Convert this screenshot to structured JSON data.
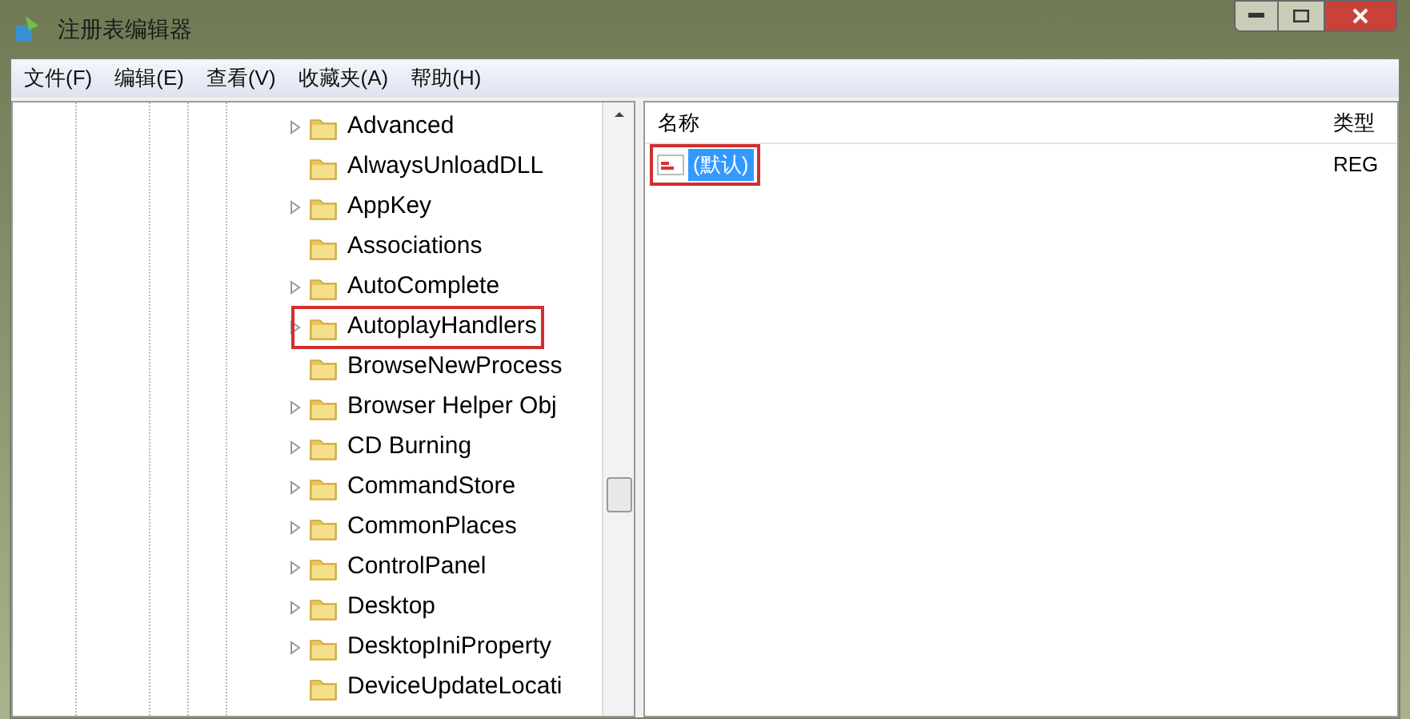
{
  "window": {
    "title": "注册表编辑器"
  },
  "menu": [
    "文件(F)",
    "编辑(E)",
    "查看(V)",
    "收藏夹(A)",
    "帮助(H)"
  ],
  "tree": [
    {
      "label": "Advanced",
      "expandable": true,
      "highlighted": false
    },
    {
      "label": "AlwaysUnloadDLL",
      "expandable": false,
      "highlighted": false
    },
    {
      "label": "AppKey",
      "expandable": true,
      "highlighted": false
    },
    {
      "label": "Associations",
      "expandable": false,
      "highlighted": false
    },
    {
      "label": "AutoComplete",
      "expandable": true,
      "highlighted": false
    },
    {
      "label": "AutoplayHandlers",
      "expandable": true,
      "highlighted": true
    },
    {
      "label": "BrowseNewProcess",
      "expandable": false,
      "highlighted": false
    },
    {
      "label": "Browser Helper Obj",
      "expandable": true,
      "highlighted": false
    },
    {
      "label": "CD Burning",
      "expandable": true,
      "highlighted": false
    },
    {
      "label": "CommandStore",
      "expandable": true,
      "highlighted": false
    },
    {
      "label": "CommonPlaces",
      "expandable": true,
      "highlighted": false
    },
    {
      "label": "ControlPanel",
      "expandable": true,
      "highlighted": false
    },
    {
      "label": "Desktop",
      "expandable": true,
      "highlighted": false
    },
    {
      "label": "DesktopIniProperty",
      "expandable": true,
      "highlighted": false
    },
    {
      "label": "DeviceUpdateLocati",
      "expandable": false,
      "highlighted": false
    }
  ],
  "values": {
    "columns": [
      "名称",
      "类型"
    ],
    "rows": [
      {
        "name": "(默认)",
        "type": "REG",
        "selected": true,
        "highlighted": true
      }
    ]
  }
}
